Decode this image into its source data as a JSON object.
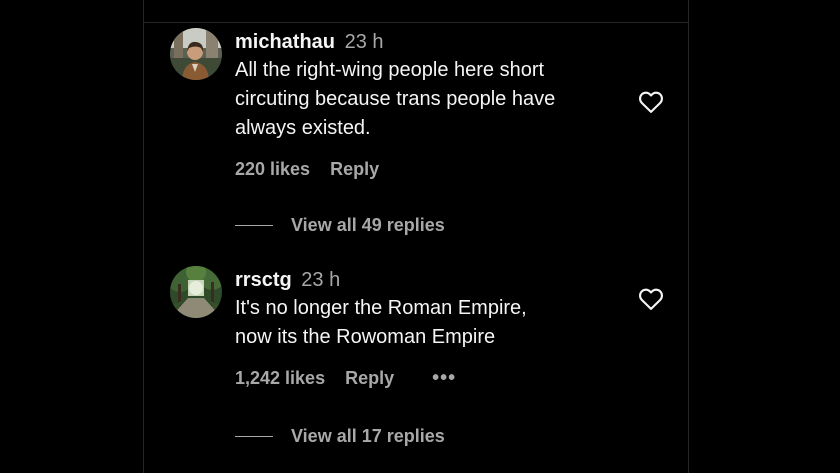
{
  "colors": {
    "background": "#000000",
    "primary_text": "#f5f5f5",
    "secondary_text": "#a8a8a8",
    "divider": "#262626"
  },
  "comments": [
    {
      "username": "michathau",
      "time": "23 h",
      "text": "All the right-wing people here short\ncircuting because trans people have\nalways existed.",
      "likes": "220 likes",
      "reply_label": "Reply",
      "like_icon": "heart-outline-icon",
      "view_replies": "View all 49 replies"
    },
    {
      "username": "rrsctg",
      "time": "23 h",
      "text": "It's no longer the Roman Empire,\nnow its the Rowoman Empire",
      "likes": "1,242 likes",
      "reply_label": "Reply",
      "more_label": "•••",
      "like_icon": "heart-outline-icon",
      "view_replies": "View all 17 replies"
    }
  ]
}
